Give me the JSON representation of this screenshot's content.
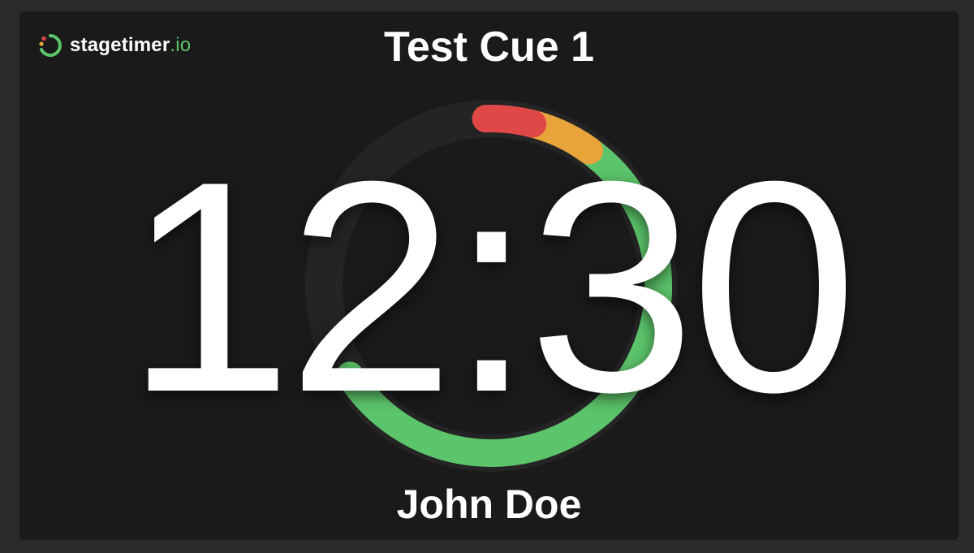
{
  "brand": {
    "name": "stagetimer",
    "suffix": ".io",
    "logo_icon": "stagetimer-logo-icon"
  },
  "cue": {
    "title": "Test Cue 1"
  },
  "timer": {
    "display": "12:30",
    "progress_remaining_fraction": 0.66,
    "warning_fraction": 0.06,
    "danger_fraction": 0.04
  },
  "speaker": {
    "name": "John Doe"
  },
  "colors": {
    "background": "#1a1a1a",
    "ring_track": "#242424",
    "progress_green": "#5cc46a",
    "warning_orange": "#e8a33a",
    "danger_red": "#e04848",
    "text": "#ffffff"
  }
}
